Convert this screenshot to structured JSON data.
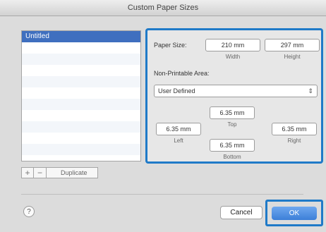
{
  "window": {
    "title": "Custom Paper Sizes"
  },
  "list": {
    "items": [
      "Untitled",
      "",
      "",
      "",
      "",
      "",
      "",
      "",
      "",
      "",
      ""
    ]
  },
  "list_toolbar": {
    "add": "+",
    "remove": "−",
    "duplicate": "Duplicate"
  },
  "panel": {
    "paper_size_label": "Paper Size:",
    "width_value": "210 mm",
    "width_caption": "Width",
    "height_value": "297 mm",
    "height_caption": "Height",
    "non_printable_label": "Non-Printable Area:",
    "printer_select": "User Defined",
    "top_value": "6.35 mm",
    "top_caption": "Top",
    "left_value": "6.35 mm",
    "left_caption": "Left",
    "bottom_value": "6.35 mm",
    "bottom_caption": "Bottom",
    "right_value": "6.35 mm",
    "right_caption": "Right"
  },
  "footer": {
    "help": "?",
    "cancel": "Cancel",
    "ok": "OK"
  },
  "colors": {
    "highlight": "#1f7ac8",
    "selection": "#3f6fbf",
    "ok_button": "#3c7fd8"
  }
}
